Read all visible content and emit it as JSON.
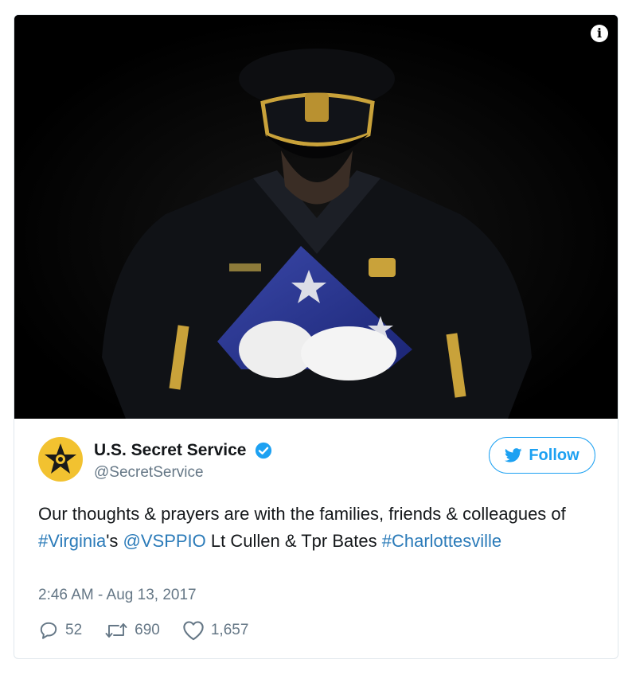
{
  "tweet": {
    "display_name": "U.S. Secret Service",
    "handle": "@SecretService",
    "follow_label": "Follow",
    "text_parts": {
      "p1": "Our thoughts & prayers are with the families, friends & colleagues of ",
      "h1": "#Virginia",
      "p2": "'s ",
      "m1": "@VSPPIO",
      "p3": " Lt Cullen & Tpr Bates ",
      "h2": "#Charlottesville"
    },
    "timestamp": "2:46 AM - Aug 13, 2017",
    "replies": "52",
    "retweets": "690",
    "likes": "1,657"
  },
  "colors": {
    "accent": "#1da1f2",
    "link": "#2b7bb9",
    "muted": "#657786"
  },
  "icons": {
    "info": "info-icon",
    "verified": "verified-badge-icon",
    "follow": "twitter-bird-icon",
    "reply": "reply-icon",
    "retweet": "retweet-icon",
    "like": "heart-icon"
  }
}
